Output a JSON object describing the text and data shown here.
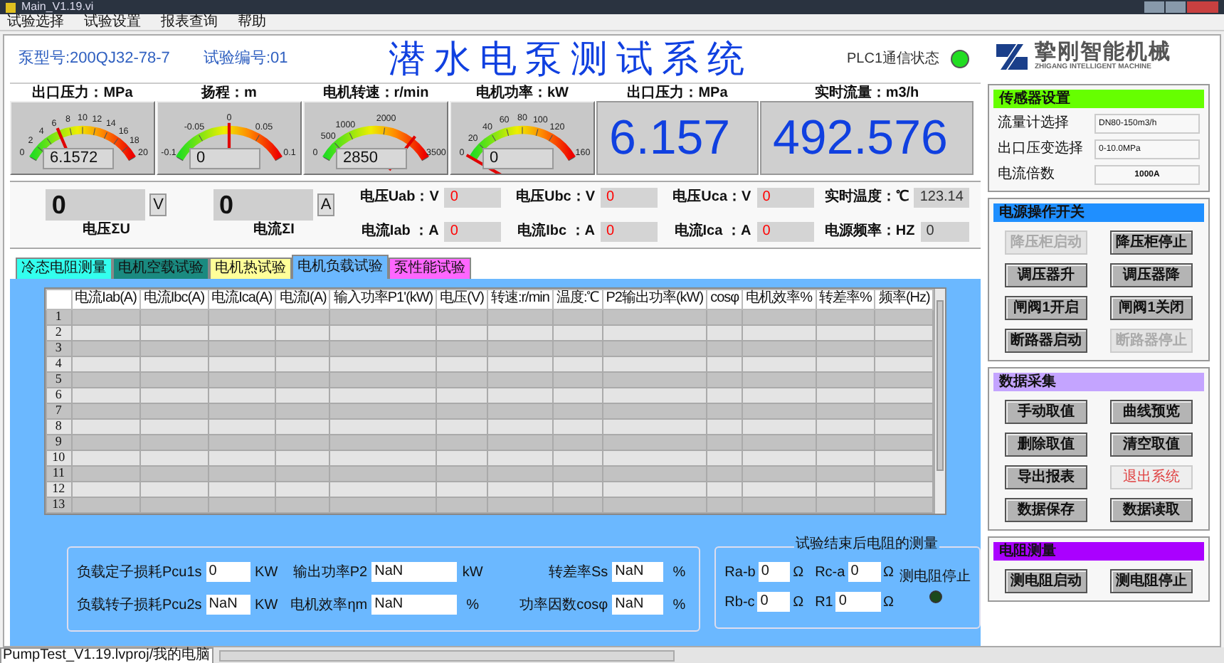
{
  "window": {
    "title": "Main_V1.19.vi"
  },
  "menu": [
    "试验选择",
    "试验设置",
    "报表查询",
    "帮助"
  ],
  "header": {
    "pump_model": "泵型号:200QJ32-78-7",
    "test_no": "试验编号:01",
    "title": "潜水电泵测试系统",
    "plc": {
      "label": "PLC1通信状态",
      "on": true
    }
  },
  "logo": {
    "name": "挚刚智能机械",
    "tagline": "ZHIGANG INTELLIGENT MACHINE"
  },
  "gauges": [
    {
      "label": "出口压力：MPa",
      "ticks": [
        "0",
        "2",
        "4",
        "6",
        "8",
        "10",
        "12",
        "14",
        "16",
        "18",
        "20"
      ],
      "value": "6.1572"
    },
    {
      "label": "扬程：m",
      "ticks": [
        "-0.1",
        "-0.05",
        "0",
        "0.05",
        "0.1"
      ],
      "value": "0"
    },
    {
      "label": "电机转速：r/min",
      "ticks": [
        "0",
        "500",
        "1000",
        "2000",
        "3500"
      ],
      "value": "2850"
    },
    {
      "label": "电机功率：kW",
      "ticks": [
        "0",
        "20",
        "40",
        "60",
        "80",
        "100",
        "120",
        "160"
      ],
      "value": "0"
    }
  ],
  "big_displays": [
    {
      "label": "出口压力：MPa",
      "value": "6.157"
    },
    {
      "label": "实时流量：m3/h",
      "value": "492.576"
    }
  ],
  "sensor_settings": {
    "title": "传感器设置",
    "rows": [
      {
        "label": "流量计选择",
        "value": "DN80-150m3/h"
      },
      {
        "label": "出口压变选择",
        "value": "0-10.0MPa"
      },
      {
        "label": "电流倍数",
        "value": "1000A"
      }
    ]
  },
  "totals": [
    {
      "value": "0",
      "unit": "V",
      "label": "电压ΣU"
    },
    {
      "value": "0",
      "unit": "A",
      "label": "电流ΣI"
    }
  ],
  "readings": [
    {
      "label": "电压Uab：V",
      "value": "0",
      "color": "#ff0000"
    },
    {
      "label": "电压Ubc：V",
      "value": "0",
      "color": "#ff0000"
    },
    {
      "label": "电压Uca：V",
      "value": "0",
      "color": "#ff0000"
    },
    {
      "label": "实时温度：℃",
      "value": "123.14",
      "color": "#333333"
    },
    {
      "label": "电流Iab ：A",
      "value": "0",
      "color": "#ff0000"
    },
    {
      "label": "电流Ibc ：A",
      "value": "0",
      "color": "#ff0000"
    },
    {
      "label": "电流Ica ：A",
      "value": "0",
      "color": "#ff0000"
    },
    {
      "label": "电源频率：HZ",
      "value": "0",
      "color": "#333333"
    }
  ],
  "tabs": [
    {
      "label": "冷态电阻测量",
      "selected": false,
      "color": "#33ffee"
    },
    {
      "label": "电机空载试验",
      "selected": false,
      "color": "#1a8a80"
    },
    {
      "label": "电机热试验",
      "selected": false,
      "color": "#ffff99"
    },
    {
      "label": "电机负载试验",
      "selected": true,
      "color": "#6bb8ff"
    },
    {
      "label": "泵性能试验",
      "selected": false,
      "color": "#ff66ff"
    }
  ],
  "table": {
    "columns": [
      "电流Iab(A)",
      "电流Ibc(A)",
      "电流Ica(A)",
      "电流I(A)",
      "输入功率P1'(kW)",
      "电压(V)",
      "转速:r/min",
      "温度:℃",
      "P2输出功率(kW)",
      "cosφ",
      "电机效率%",
      "转差率%",
      "频率(Hz)"
    ],
    "row_numbers": [
      "1",
      "2",
      "3",
      "4",
      "5",
      "6",
      "7",
      "8",
      "9",
      "10",
      "11",
      "12",
      "13"
    ]
  },
  "losses": [
    {
      "label": "负载定子损耗Pcu1s",
      "value": "0",
      "unit": "KW"
    },
    {
      "label": "输出功率P2",
      "value": "NaN",
      "unit": "kW"
    },
    {
      "label": "转差率Ss",
      "value": "NaN",
      "unit": "%"
    },
    {
      "label": "负载转子损耗Pcu2s",
      "value": "NaN",
      "unit": "KW"
    },
    {
      "label": "电机效率ηm",
      "value": "NaN",
      "unit": "%"
    },
    {
      "label": "功率因数cosφ",
      "value": "NaN",
      "unit": "%"
    }
  ],
  "resistance": {
    "title": "试验结束后电阻的测量",
    "fields": [
      {
        "label": "Ra-b",
        "value": "0",
        "unit": "Ω"
      },
      {
        "label": "Rc-a",
        "value": "0",
        "unit": "Ω"
      },
      {
        "label": "Rb-c",
        "value": "0",
        "unit": "Ω"
      },
      {
        "label": "R1",
        "value": "0",
        "unit": "Ω"
      }
    ],
    "led": {
      "label": "测电阻停止",
      "on": false
    }
  },
  "power_ops": {
    "title": "电源操作开关",
    "buttons": [
      {
        "label": "降压柜启动",
        "disabled": true
      },
      {
        "label": "降压柜停止",
        "disabled": false
      },
      {
        "label": "调压器升",
        "disabled": false
      },
      {
        "label": "调压器降",
        "disabled": false
      },
      {
        "label": "闸阀1开启",
        "disabled": false
      },
      {
        "label": "闸阀1关闭",
        "disabled": false
      },
      {
        "label": "断路器启动",
        "disabled": false
      },
      {
        "label": "断路器停止",
        "disabled": true
      }
    ]
  },
  "data_collection": {
    "title": "数据采集",
    "buttons": [
      {
        "label": "手动取值",
        "disabled": false,
        "kind": "normal"
      },
      {
        "label": "曲线预览",
        "disabled": false,
        "kind": "normal"
      },
      {
        "label": "删除取值",
        "disabled": false,
        "kind": "normal"
      },
      {
        "label": "清空取值",
        "disabled": false,
        "kind": "normal"
      },
      {
        "label": "导出报表",
        "disabled": false,
        "kind": "normal"
      },
      {
        "label": "退出系统",
        "disabled": false,
        "kind": "exit"
      },
      {
        "label": "数据保存",
        "disabled": false,
        "kind": "normal"
      },
      {
        "label": "数据读取",
        "disabled": false,
        "kind": "normal"
      }
    ]
  },
  "resistance_test": {
    "title": "电阻测量",
    "buttons": [
      {
        "label": "测电阻启动",
        "disabled": false
      },
      {
        "label": "测电阻停止",
        "disabled": false
      }
    ]
  },
  "status_bar": {
    "path": "PumpTest_V1.19.lvproj/我的电脑"
  }
}
